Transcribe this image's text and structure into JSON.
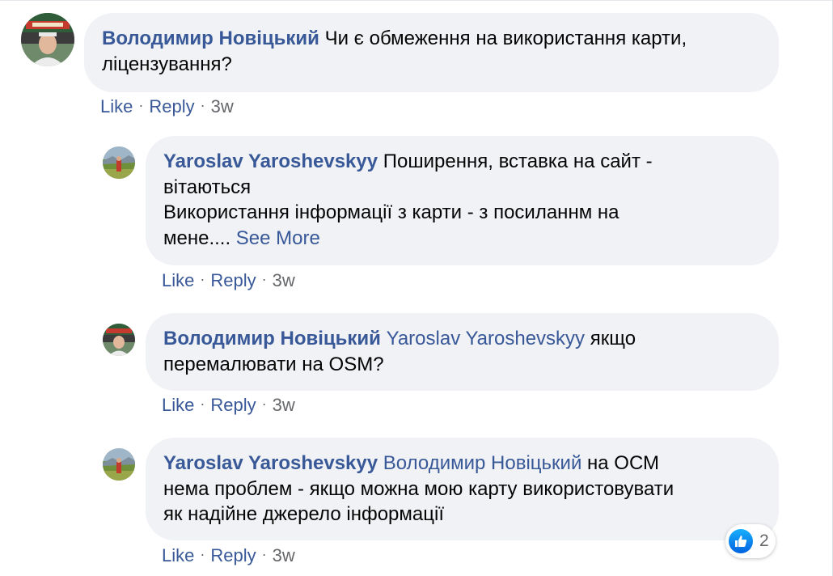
{
  "comments": [
    {
      "author": "Володимир Новіцький",
      "mention": "",
      "lines": [
        "Чи є обмеження на використання карти,",
        "ліцензування?"
      ],
      "actions": {
        "like": "Like",
        "reply": "Reply",
        "time": "3w"
      }
    },
    {
      "author": "Yaroslav Yaroshevskyy",
      "mention": "",
      "lines": [
        "Поширення, вставка на сайт -",
        "вітаються",
        "Використання інформації з карти - з посиланнм на",
        "мене...."
      ],
      "see_more": "See More",
      "actions": {
        "like": "Like",
        "reply": "Reply",
        "time": "3w"
      }
    },
    {
      "author": "Володимир Новіцький",
      "mention": "Yaroslav Yaroshevskyy",
      "lines": [
        "якщо",
        "перемалювати на OSM?"
      ],
      "actions": {
        "like": "Like",
        "reply": "Reply",
        "time": "3w"
      }
    },
    {
      "author": "Yaroslav Yaroshevskyy",
      "mention": "Володимир Новіцький",
      "lines": [
        "на ОСМ",
        "нема проблем - якщо можна мою карту використовувати",
        "як надійне джерело інформації"
      ],
      "actions": {
        "like": "Like",
        "reply": "Reply",
        "time": "3w"
      },
      "reactions": {
        "icon": "like-reaction-icon",
        "count": "2"
      }
    }
  ],
  "separator": "·",
  "colors": {
    "link": "#385898",
    "bubble": "#f0f2f5",
    "meta": "#65676b"
  }
}
